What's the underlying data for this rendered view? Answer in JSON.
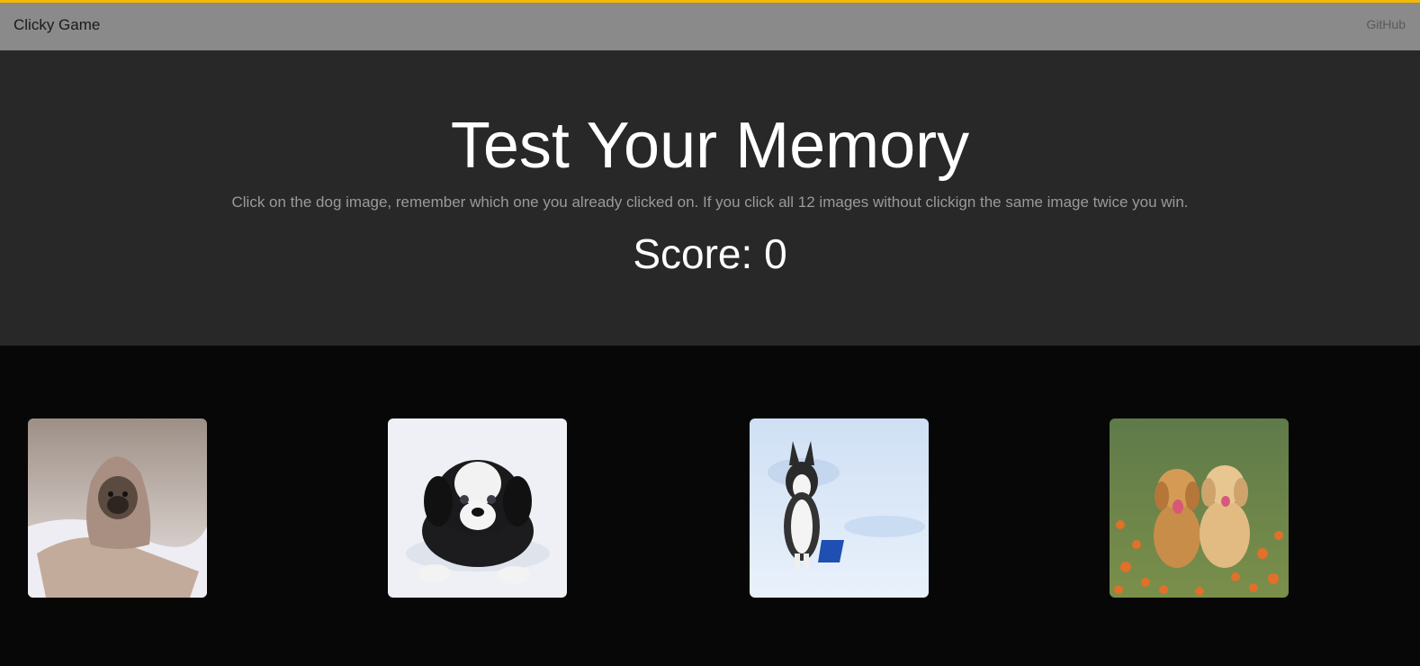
{
  "navbar": {
    "brand": "Clicky Game",
    "link_label": "GitHub"
  },
  "hero": {
    "title": "Test Your Memory",
    "subtitle": "Click on the dog image, remember which one you already clicked on. If you click all 12 images without clickign the same image twice you win.",
    "score_label": "Score: 0"
  },
  "cards": [
    {
      "icon": "pug-in-blanket-image"
    },
    {
      "icon": "black-white-puppy-image"
    },
    {
      "icon": "husky-in-snow-image"
    },
    {
      "icon": "two-golden-puppies-image"
    }
  ],
  "colors": {
    "accent": "#f5b800",
    "navbar": "#8a8a8a",
    "hero_bg": "#282828",
    "page_bg": "#070707"
  }
}
